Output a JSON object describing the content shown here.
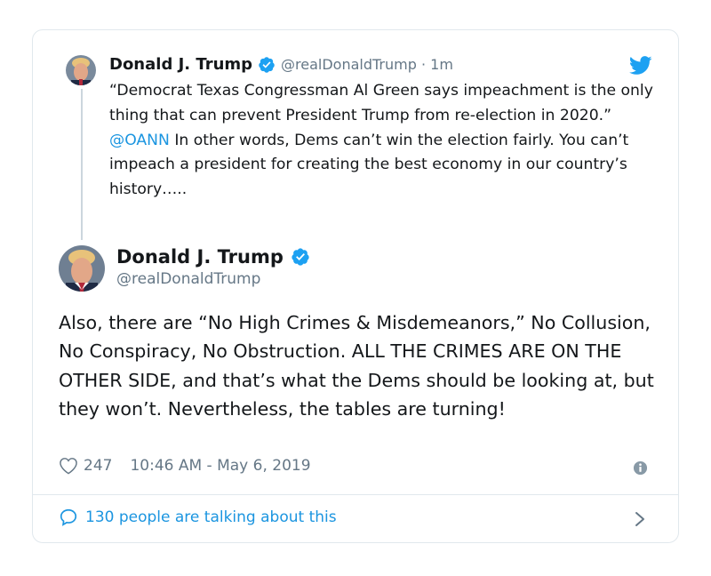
{
  "parent_tweet": {
    "author_name": "Donald J. Trump",
    "handle_time": "@realDonaldTrump · 1m",
    "text_before": "“Democrat Texas Congressman Al Green says impeachment is the only thing that can prevent President Trump from re-election in 2020.” ",
    "mention": "@OANN",
    "text_after": "  In other words, Dems can’t win the election fairly. You can’t impeach a president for creating the best economy in our country’s history….."
  },
  "main_tweet": {
    "author_name": "Donald J. Trump",
    "handle": "@realDonaldTrump",
    "text": "Also, there are “No High Crimes & Misdemeanors,” No Collusion, No Conspiracy, No Obstruction. ALL THE CRIMES ARE ON THE OTHER SIDE, and that’s what the Dems should be looking at, but they won’t. Nevertheless, the tables are turning!",
    "likes": "247",
    "timestamp": "10:46 AM - May 6, 2019"
  },
  "talking": {
    "label": "130 people are talking about this"
  },
  "colors": {
    "accent": "#1b95e0",
    "verified": "#1da1f2",
    "muted": "#657786",
    "border": "#e1e8ed"
  },
  "icons": [
    "verified-badge-icon",
    "twitter-bird-icon",
    "heart-icon",
    "info-icon",
    "speech-bubble-icon",
    "chevron-right-icon"
  ]
}
